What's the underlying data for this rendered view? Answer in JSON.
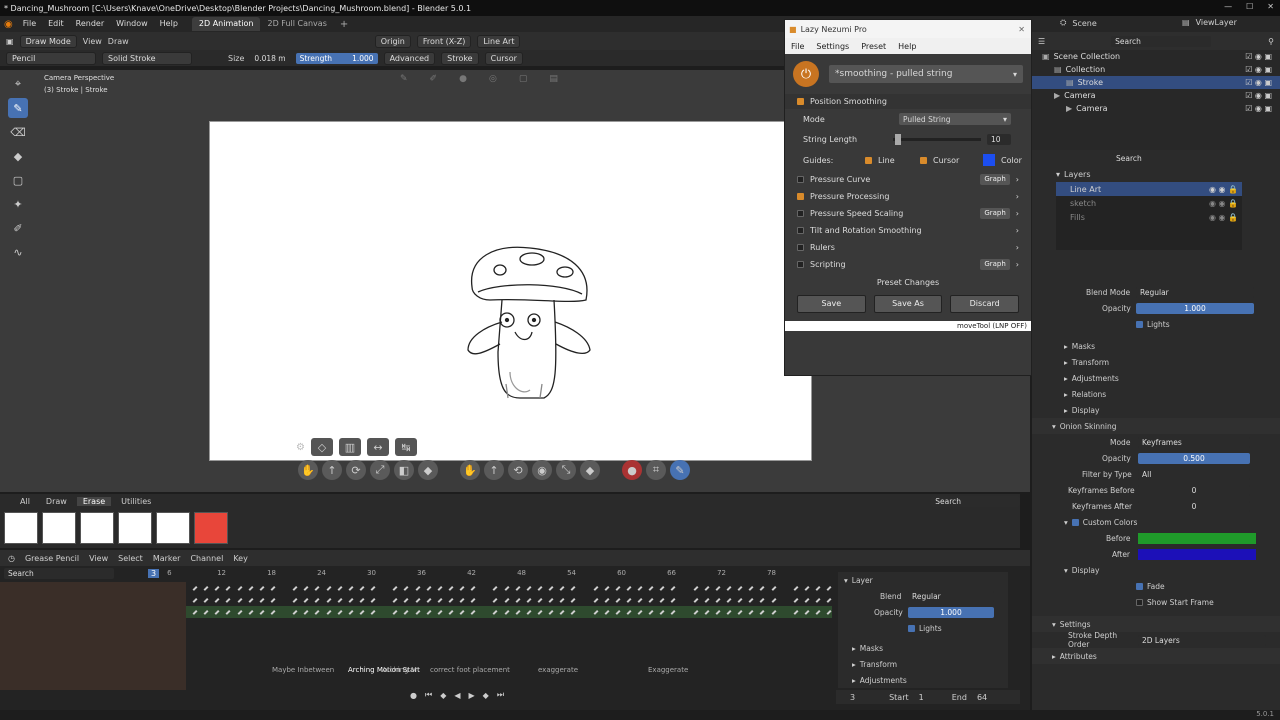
{
  "window_title": "* Dancing_Mushroom [C:\\Users\\Knave\\OneDrive\\Desktop\\Blender Projects\\Dancing_Mushroom.blend] - Blender 5.0.1",
  "menu": [
    "File",
    "Edit",
    "Render",
    "Window",
    "Help"
  ],
  "workspaces": [
    "2D Animation",
    "2D Full Canvas"
  ],
  "top_right": {
    "scene": "Scene",
    "view_layer": "ViewLayer"
  },
  "viewport_header": {
    "mode": "Draw Mode",
    "view": "View",
    "draw": "Draw",
    "origin": "Origin",
    "placement": "Front (X-Z)",
    "layer": "Line Art"
  },
  "tool_header": {
    "brush": "Pencil",
    "material": "Solid Stroke",
    "size_label": "Size",
    "size_value": "0.018 m",
    "strength_label": "Strength",
    "strength_value": "1.000",
    "advanced": "Advanced",
    "stroke": "Stroke",
    "cursor": "Cursor"
  },
  "viewport_overlay": {
    "camera": "Camera Perspective",
    "object": "(3) Stroke | Stroke"
  },
  "lnp": {
    "title": "Lazy Nezumi Pro",
    "menu": [
      "File",
      "Settings",
      "Preset",
      "Help"
    ],
    "preset": "*smoothing - pulled string",
    "position_smoothing": "Position Smoothing",
    "mode_label": "Mode",
    "mode_value": "Pulled String",
    "string_length_label": "String Length",
    "string_length_value": "10",
    "guides_label": "Guides:",
    "guide_line": "Line",
    "guide_cursor": "Cursor",
    "guide_color": "Color",
    "options": [
      {
        "label": "Pressure Curve",
        "checked": false,
        "graph": true
      },
      {
        "label": "Pressure Processing",
        "checked": true,
        "graph": false
      },
      {
        "label": "Pressure Speed Scaling",
        "checked": false,
        "graph": true
      },
      {
        "label": "Tilt and Rotation Smoothing",
        "checked": false,
        "graph": false
      },
      {
        "label": "Rulers",
        "checked": false,
        "graph": false
      },
      {
        "label": "Scripting",
        "checked": false,
        "graph": true
      }
    ],
    "graph_label": "Graph",
    "preset_changes": "Preset Changes",
    "save": "Save",
    "save_as": "Save As",
    "discard": "Discard",
    "status": "moveTool (LNP OFF)"
  },
  "outliner": {
    "search_placeholder": "Search",
    "items": [
      {
        "label": "Scene Collection",
        "indent": 0
      },
      {
        "label": "Collection",
        "indent": 1
      },
      {
        "label": "Stroke",
        "indent": 2
      },
      {
        "label": "Camera",
        "indent": 1
      },
      {
        "label": "Camera",
        "indent": 2
      }
    ]
  },
  "layers": {
    "title": "Layers",
    "search_placeholder": "Search",
    "items": [
      "Line Art",
      "sketch",
      "Fills"
    ],
    "blend_mode_label": "Blend Mode",
    "blend_mode": "Regular",
    "opacity_label": "Opacity",
    "opacity": "1.000",
    "lights": "Lights",
    "sections": [
      "Masks",
      "Transform",
      "Adjustments",
      "Relations",
      "Display"
    ],
    "onion": {
      "title": "Onion Skinning",
      "mode_label": "Mode",
      "mode": "Keyframes",
      "opacity_label": "Opacity",
      "opacity": "0.500",
      "filter_label": "Filter by Type",
      "filter": "All",
      "before_label": "Keyframes Before",
      "before": "0",
      "after_label": "Keyframes After",
      "after": "0",
      "custom_colors": "Custom Colors",
      "before_color_label": "Before",
      "after_color_label": "After",
      "display": "Display",
      "fade": "Fade",
      "show_start": "Show Start Frame"
    },
    "settings": "Settings",
    "depth_label": "Stroke Depth Order",
    "depth": "2D Layers",
    "attributes": "Attributes"
  },
  "asset_tabs": [
    "All",
    "Draw",
    "Erase",
    "Utilities"
  ],
  "asset_search": "Search",
  "dopesheet": {
    "mode": "Grease Pencil",
    "menus": [
      "View",
      "Select",
      "Marker",
      "Channel",
      "Key"
    ],
    "search_placeholder": "Search",
    "current_frame": "3",
    "ticks": [
      "6",
      "12",
      "18",
      "24",
      "30",
      "36",
      "42",
      "48",
      "54",
      "60",
      "66",
      "72",
      "78"
    ],
    "markers": [
      "Maybe Inbetween",
      "Arching Motion Start",
      "Arching M",
      "correct foot placement",
      "exaggerate",
      "Exaggerate"
    ],
    "side": {
      "title": "Layer",
      "blend_label": "Blend",
      "blend": "Regular",
      "opacity_label": "Opacity",
      "opacity": "1.000",
      "lights": "Lights",
      "sections": [
        "Masks",
        "Transform",
        "Adjustments"
      ]
    },
    "playback": {
      "frame": "3",
      "start_label": "Start",
      "start": "1",
      "end_label": "End",
      "end": "64"
    }
  },
  "version": "5.0.1",
  "colors": {
    "accent": "#4772b3",
    "orange": "#d98b2b",
    "before": "#1f9a2a",
    "after": "#1c10b8"
  }
}
